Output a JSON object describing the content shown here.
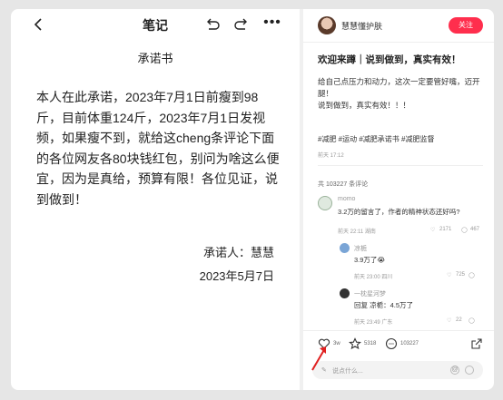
{
  "note": {
    "title": "笔记",
    "heading": "承诺书",
    "body": "本人在此承诺，2023年7月1日前瘦到98斤，目前体重124斤，2023年7月1日发视频，如果瘦不到，就给这cheng条评论下面的各位网友各80块钱红包，别问为啥这么便宜，因为是真给，预算有限！各位见证，说到做到！",
    "signer": "承诺人：慧慧",
    "date": "2023年5月7日"
  },
  "post": {
    "author": "慧慧懂护肤",
    "follow": "关注",
    "title": "欢迎来蹲｜说到做到，真实有效！",
    "body_line1": "给自己点压力和动力，这次一定要管好嘴，迈开腿！",
    "body_line2": "说到做到，真实有效！！！",
    "tags": "#减肥 #运动 #减肥承诺书 #减肥监督",
    "time": "前天 17:12",
    "comments_total": "共 103227 条评论"
  },
  "comments": [
    {
      "name": "momo",
      "text": "3.2万的留言了，作者的精神状态还好吗?",
      "meta": "前天 22:11 湖南",
      "likes": "2171",
      "replies": "467"
    },
    {
      "name": "凉栀",
      "text": "3.9万了😭",
      "meta": "前天 23:00 四川",
      "likes": "725"
    },
    {
      "name": "一枕星河梦",
      "text": "回复 凉栀：4.5万了",
      "meta": "前天 23:49 广东",
      "likes": "22"
    }
  ],
  "actions": {
    "likes": "3w",
    "stars": "5318",
    "comments": "103227"
  },
  "input": {
    "placeholder": "说点什么...",
    "at": "@"
  },
  "colors": {
    "accent": "#ff2e4d",
    "annotation": "#e02020"
  }
}
